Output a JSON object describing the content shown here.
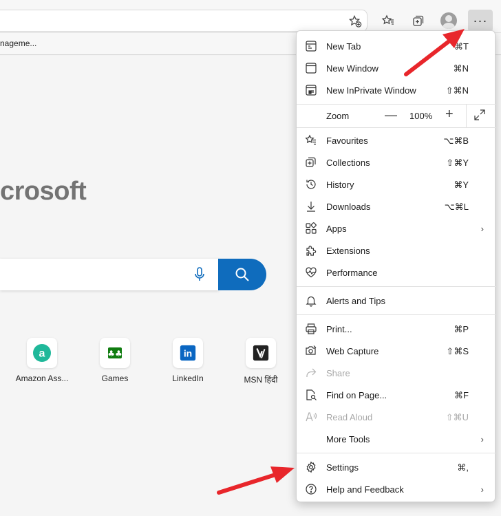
{
  "favourites_bar": {
    "item": "nageme..."
  },
  "page": {
    "brand": "crosoft",
    "tiles": [
      {
        "label": "Amazon Ass..."
      },
      {
        "label": "Games"
      },
      {
        "label": "LinkedIn"
      },
      {
        "label": "MSN हिंदी"
      }
    ]
  },
  "menu": {
    "new_tab": {
      "label": "New Tab",
      "shortcut": "⌘T"
    },
    "new_window": {
      "label": "New Window",
      "shortcut": "⌘N"
    },
    "new_inprivate": {
      "label": "New InPrivate Window",
      "shortcut": "⇧⌘N"
    },
    "zoom": {
      "label": "Zoom",
      "value": "100%",
      "minus": "—",
      "plus": "+"
    },
    "favourites": {
      "label": "Favourites",
      "shortcut": "⌥⌘B"
    },
    "collections": {
      "label": "Collections",
      "shortcut": "⇧⌘Y"
    },
    "history": {
      "label": "History",
      "shortcut": "⌘Y"
    },
    "downloads": {
      "label": "Downloads",
      "shortcut": "⌥⌘L"
    },
    "apps": {
      "label": "Apps"
    },
    "extensions": {
      "label": "Extensions"
    },
    "performance": {
      "label": "Performance"
    },
    "alerts": {
      "label": "Alerts and Tips"
    },
    "print": {
      "label": "Print...",
      "shortcut": "⌘P"
    },
    "web_capture": {
      "label": "Web Capture",
      "shortcut": "⇧⌘S"
    },
    "share": {
      "label": "Share"
    },
    "find": {
      "label": "Find on Page...",
      "shortcut": "⌘F"
    },
    "read_aloud": {
      "label": "Read Aloud",
      "shortcut": "⇧⌘U"
    },
    "more_tools": {
      "label": "More Tools"
    },
    "settings": {
      "label": "Settings",
      "shortcut": "⌘,"
    },
    "help": {
      "label": "Help and Feedback"
    }
  },
  "toolbar": {
    "more_label": "···"
  },
  "colors": {
    "accent": "#0f6cbd",
    "annotation_arrow": "#e8262b"
  }
}
